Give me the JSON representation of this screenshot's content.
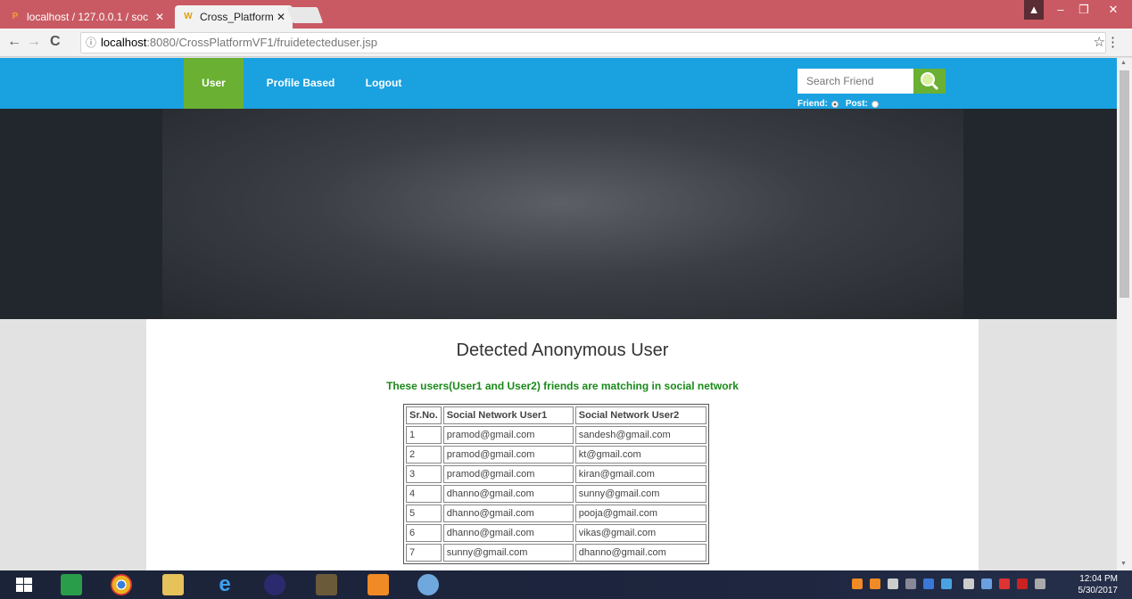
{
  "browser": {
    "tabs": [
      {
        "label": "localhost / 127.0.0.1 / soc",
        "favicon": "phpmyadmin-icon"
      },
      {
        "label": "Cross_Platform",
        "favicon": "w-icon"
      }
    ],
    "url_host": "localhost",
    "url_path": ":8080/CrossPlatformVF1/fruidetecteduser.jsp"
  },
  "nav": {
    "items": [
      "User",
      "Profile Based",
      "Logout"
    ],
    "search_placeholder": "Search Friend",
    "radio_friend": "Friend:",
    "radio_post": "Post:"
  },
  "page": {
    "heading": "Detected Anonymous User",
    "subheading": "These users(User1 and User2) friends are matching in social network"
  },
  "table": {
    "headers": [
      "Sr.No.",
      "Social Network User1",
      "Social Network User2"
    ],
    "rows": [
      [
        "1",
        "pramod@gmail.com",
        "sandesh@gmail.com"
      ],
      [
        "2",
        "pramod@gmail.com",
        "kt@gmail.com"
      ],
      [
        "3",
        "pramod@gmail.com",
        "kiran@gmail.com"
      ],
      [
        "4",
        "dhanno@gmail.com",
        "sunny@gmail.com"
      ],
      [
        "5",
        "dhanno@gmail.com",
        "pooja@gmail.com"
      ],
      [
        "6",
        "dhanno@gmail.com",
        "vikas@gmail.com"
      ],
      [
        "7",
        "sunny@gmail.com",
        "dhanno@gmail.com"
      ]
    ]
  },
  "taskbar": {
    "time": "12:04 PM",
    "date": "5/30/2017"
  },
  "colors": {
    "nav_bg": "#1aa1e0",
    "nav_active": "#6ab033",
    "subheading": "#1a8a1a",
    "tabbar": "#c95a63"
  }
}
